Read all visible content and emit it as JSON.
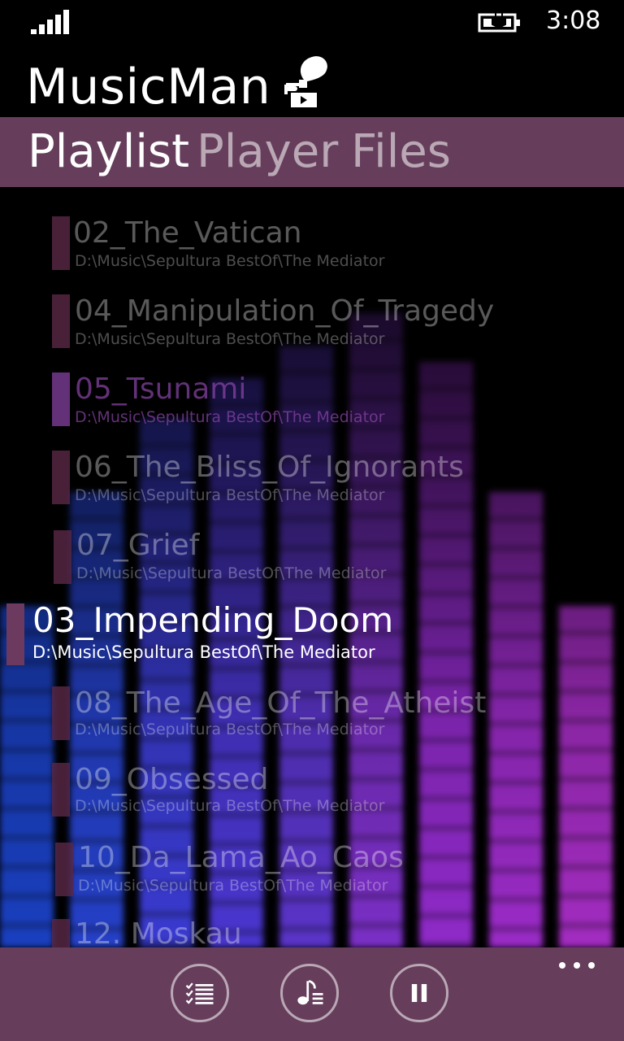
{
  "status_bar": {
    "time": "3:08",
    "signal_icon": "signal-strength-icon",
    "battery_icon": "battery-charging-icon"
  },
  "app": {
    "title": "MusicMan",
    "logo_icon": "gramophone-icon"
  },
  "tabs": [
    {
      "label": "Playlist",
      "active": true
    },
    {
      "label": "Player",
      "active": false
    },
    {
      "label": "Files",
      "active": false
    }
  ],
  "playlist": [
    {
      "title": "02_The_Vatican",
      "path": "D:\\Music\\Sepultura BestOf\\The Mediator"
    },
    {
      "title": "04_Manipulation_Of_Tragedy",
      "path": "D:\\Music\\Sepultura BestOf\\The Mediator"
    },
    {
      "title": "05_Tsunami",
      "path": "D:\\Music\\Sepultura BestOf\\The Mediator"
    },
    {
      "title": "06_The_Bliss_Of_Ignorants",
      "path": "D:\\Music\\Sepultura BestOf\\The Mediator"
    },
    {
      "title": "07_Grief",
      "path": "D:\\Music\\Sepultura BestOf\\The Mediator"
    },
    {
      "title": "03_Impending_Doom",
      "path": "D:\\Music\\Sepultura BestOf\\The Mediator",
      "current": true
    },
    {
      "title": "08_The_Age_Of_The_Atheist",
      "path": "D:\\Music\\Sepultura BestOf\\The Mediator"
    },
    {
      "title": "09_Obsessed",
      "path": "D:\\Music\\Sepultura BestOf\\The Mediator"
    },
    {
      "title": "10_Da_Lama_Ao_Caos",
      "path": "D:\\Music\\Sepultura BestOf\\The Mediator"
    },
    {
      "title": "12. Moskau",
      "path": ""
    }
  ],
  "app_bar": {
    "buttons": [
      {
        "icon": "playlist-icon"
      },
      {
        "icon": "music-note-list-icon"
      },
      {
        "icon": "pause-icon"
      }
    ],
    "more_icon": "more-ellipsis-icon"
  },
  "colors": {
    "accent": "#663e5c",
    "current_marker": "#6c3a5e"
  }
}
